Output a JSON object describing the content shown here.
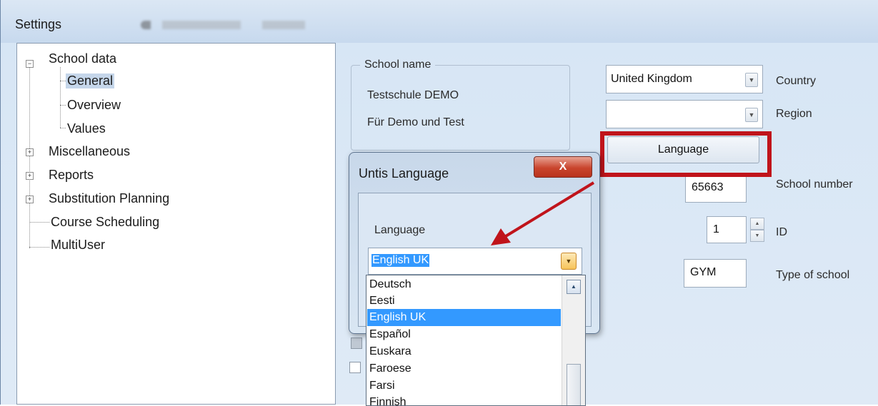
{
  "window": {
    "title": "Settings"
  },
  "tree": {
    "items": [
      {
        "label": "School data",
        "expander": "minus"
      },
      {
        "label": "General",
        "selected": true
      },
      {
        "label": "Overview"
      },
      {
        "label": "Values"
      },
      {
        "label": "Miscellaneous",
        "expander": "plus"
      },
      {
        "label": "Reports",
        "expander": "plus"
      },
      {
        "label": "Substitution Planning",
        "expander": "plus"
      },
      {
        "label": "Course Scheduling"
      },
      {
        "label": "MultiUser"
      }
    ]
  },
  "school_name": {
    "legend": "School name",
    "line1": "Testschule  DEMO",
    "line2": "Für Demo und Test"
  },
  "country": {
    "value": "United Kingdom",
    "label": "Country"
  },
  "region": {
    "value": "",
    "label": "Region"
  },
  "language_button": {
    "label": "Language"
  },
  "school_number": {
    "value": "65663",
    "label": "School number"
  },
  "id_field": {
    "value": "1",
    "label": "ID"
  },
  "school_type": {
    "value": "GYM",
    "label": "Type of school"
  },
  "dialog": {
    "title": "Untis Language",
    "close_label": "X",
    "language_label": "Language",
    "selected_value": "English UK"
  },
  "language_list": {
    "items": [
      "Deutsch",
      "Eesti",
      "English UK",
      "Español",
      "Euskara",
      "Faroese",
      "Farsi",
      "Finnish"
    ],
    "selected": "English UK"
  },
  "colors": {
    "highlight_box": "#c0141b",
    "arrow": "#c0141b",
    "selection": "#3399ff"
  },
  "icons": {
    "combo_arrow": "chevron-down-icon",
    "scroll_up": "chevron-up-icon",
    "close": "close-icon"
  }
}
